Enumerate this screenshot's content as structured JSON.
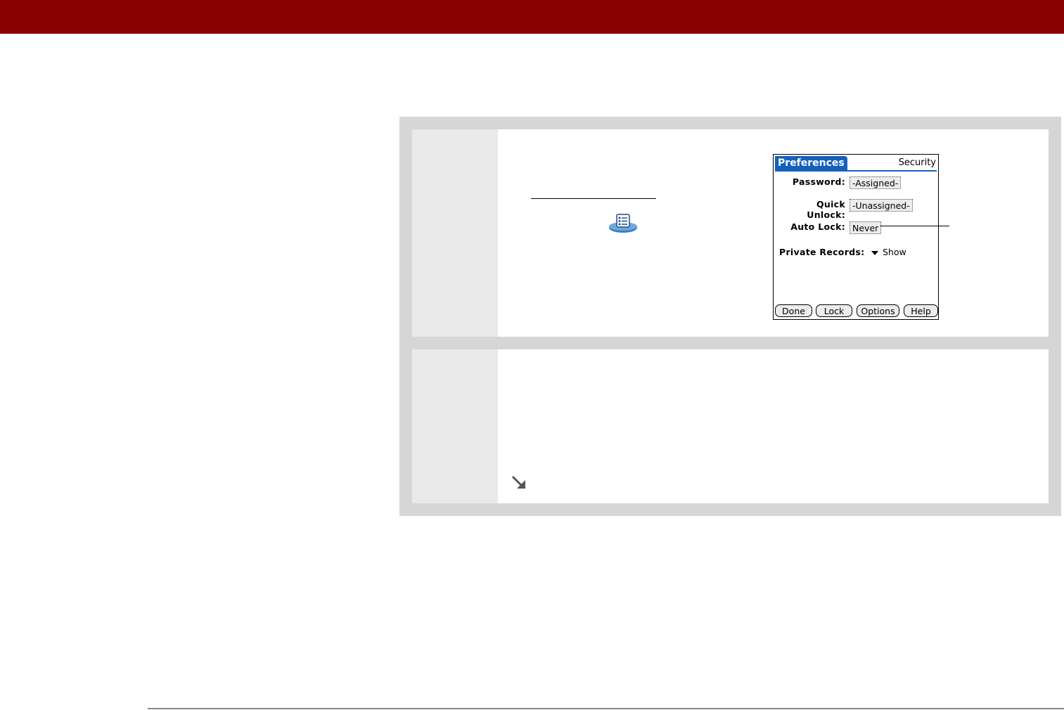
{
  "palm": {
    "title": "Preferences",
    "category": "Security",
    "fields": {
      "password_label": "Password:",
      "password_value": "-Assigned-",
      "quick_unlock_label": "Quick Unlock:",
      "quick_unlock_value": "-Unassigned-",
      "auto_lock_label": "Auto Lock:",
      "auto_lock_value": "Never"
    },
    "private_records_label": "Private Records:",
    "private_records_value": "Show",
    "buttons": {
      "done": "Done",
      "lock": "Lock",
      "options": "Options",
      "help": "Help"
    }
  },
  "icons": {
    "app_icon": "preferences-icon",
    "next_arrow": "arrow-down-right-icon"
  },
  "colors": {
    "header": "#8b0000",
    "palm_accent": "#1560bd"
  }
}
